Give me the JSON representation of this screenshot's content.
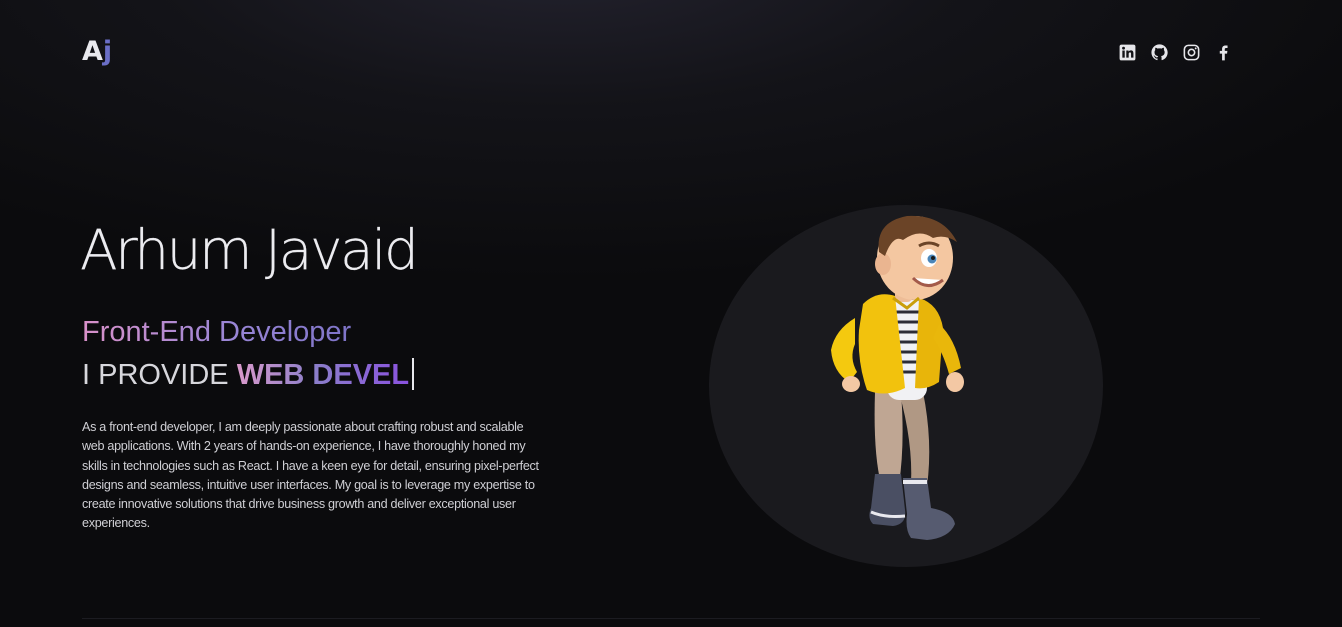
{
  "logo": {
    "letter1": "A",
    "letter2": "j"
  },
  "socials": [
    {
      "name": "linkedin",
      "icon": "linkedin-icon"
    },
    {
      "name": "github",
      "icon": "github-icon"
    },
    {
      "name": "instagram",
      "icon": "instagram-icon"
    },
    {
      "name": "facebook",
      "icon": "facebook-icon"
    }
  ],
  "hero": {
    "name": "Arhum Javaid",
    "role": "Front-End Developer",
    "provide_lead": "I PROVIDE ",
    "provide_typed": "WEB DEVEL",
    "bio": "As a front-end developer, I am deeply passionate about crafting robust and scalable web applications. With 2 years of hands-on experience, I have thoroughly honed my skills in technologies such as React. I have a keen eye for detail, ensuring pixel-perfect designs and seamless, intuitive user interfaces. My goal is to leverage my expertise to create innovative solutions that drive business growth and deliver exceptional user experiences."
  },
  "colors": {
    "background": "#0b0b0d",
    "accent_purple": "#6a6ec6",
    "gradient_pink": "#d991c9",
    "gradient_violet": "#8a52df",
    "circle": "#1a1a1e"
  },
  "illustration": {
    "subject": "cartoon-boy-yellow-jacket"
  }
}
